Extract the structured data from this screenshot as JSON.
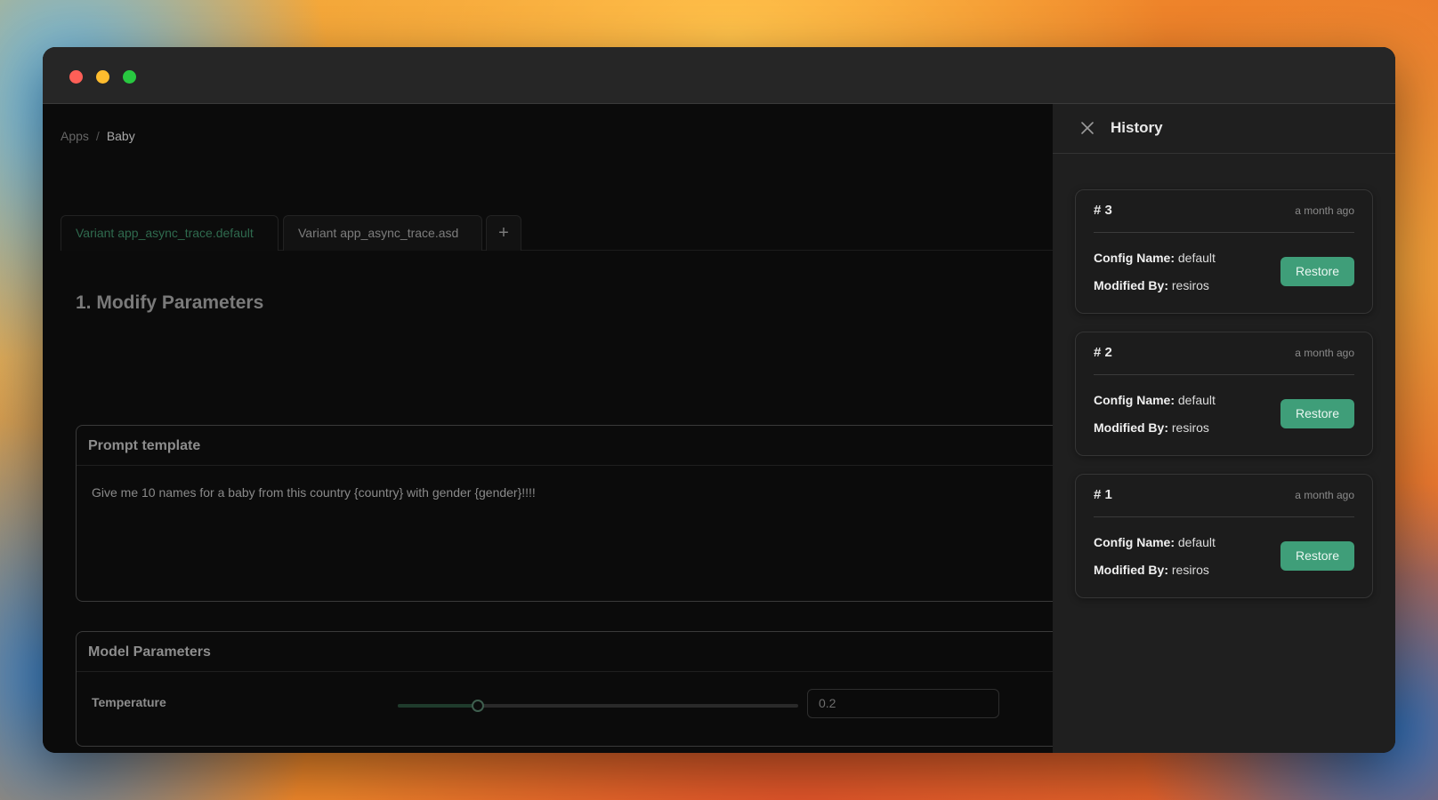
{
  "breadcrumb": {
    "root": "Apps",
    "separator": "/",
    "current": "Baby"
  },
  "tabs": [
    {
      "label": "Variant app_async_trace.default",
      "active": true
    },
    {
      "label": "Variant app_async_trace.asd",
      "active": false
    }
  ],
  "add_tab_label": "+",
  "section_title": "1. Modify Parameters",
  "prompt": {
    "header": "Prompt template",
    "text": "Give me 10 names for a baby from this country {country} with gender {gender}!!!!"
  },
  "model_params": {
    "header": "Model Parameters",
    "temperature_label": "Temperature",
    "temperature_value": "0.2",
    "temperature_fraction": 0.2
  },
  "history": {
    "title": "History",
    "items": [
      {
        "num": "# 3",
        "time": "a month ago",
        "config_label": "Config Name:",
        "config_value": "default",
        "modified_label": "Modified By:",
        "modified_value": "resiros",
        "button": "Restore"
      },
      {
        "num": "# 2",
        "time": "a month ago",
        "config_label": "Config Name:",
        "config_value": "default",
        "modified_label": "Modified By:",
        "modified_value": "resiros",
        "button": "Restore"
      },
      {
        "num": "# 1",
        "time": "a month ago",
        "config_label": "Config Name:",
        "config_value": "default",
        "modified_label": "Modified By:",
        "modified_value": "resiros",
        "button": "Restore"
      }
    ]
  },
  "colors": {
    "accent": "#3f9e79",
    "panel": "#1f1f1f",
    "background": "#0b0b0b"
  },
  "icons": {
    "close": "close-icon",
    "add": "plus-icon"
  }
}
